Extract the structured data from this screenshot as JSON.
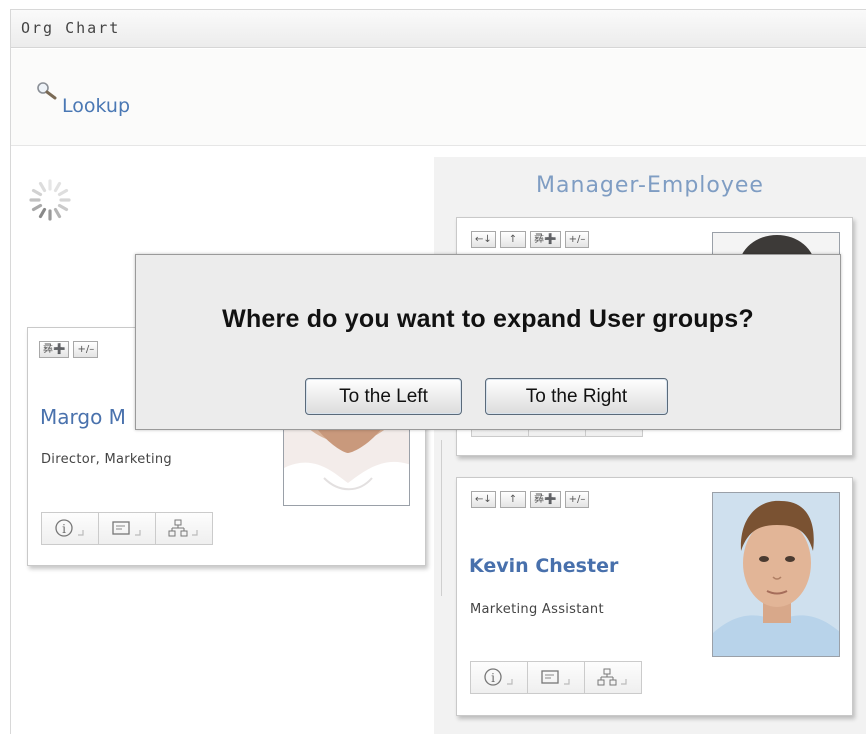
{
  "portlet": {
    "title": "Org Chart"
  },
  "lookup": {
    "label": "Lookup",
    "icon": "magnifier-icon"
  },
  "panel": {
    "title": "Manager-Employee"
  },
  "toolbar": {
    "show_up": "↑",
    "expand_groups": "彞➕",
    "collapse": "+/–",
    "move": "←↓"
  },
  "cards": [
    {
      "name": "Margo M",
      "role": "Director, Marketing"
    },
    {
      "name": "",
      "role": ""
    },
    {
      "name": "Kevin Chester",
      "role": "Marketing Assistant"
    }
  ],
  "actions": [
    {
      "name": "info-icon"
    },
    {
      "name": "email-icon"
    },
    {
      "name": "org-chart-icon"
    }
  ],
  "dialog": {
    "question": "Where do you want to expand User groups?",
    "left_label": "To the Left",
    "right_label": "To the Right"
  },
  "colors": {
    "accent": "#4a78b4",
    "panel_title": "#7f9dc3",
    "panel_bg": "#f2f2f2",
    "dialog_bg": "#ececec"
  }
}
